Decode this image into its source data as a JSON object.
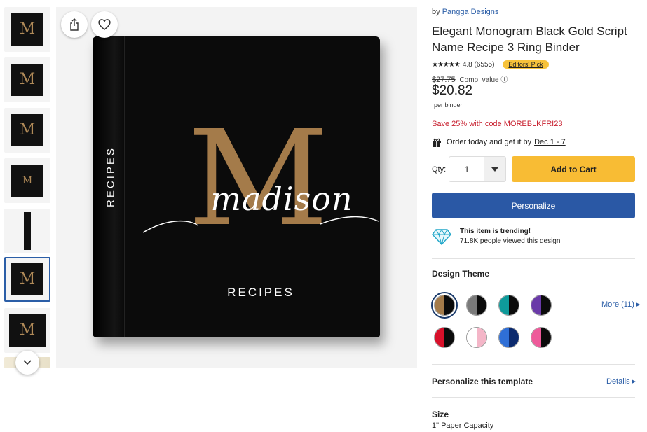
{
  "thumbnails": [
    {
      "kind": "front",
      "label": "M"
    },
    {
      "kind": "front",
      "label": "M"
    },
    {
      "kind": "front",
      "label": "M"
    },
    {
      "kind": "front",
      "label": "M"
    },
    {
      "kind": "spine",
      "label": ""
    },
    {
      "kind": "front",
      "label": "M"
    },
    {
      "kind": "open",
      "label": "M"
    },
    {
      "kind": "partial",
      "label": ""
    }
  ],
  "product_image": {
    "monogram": "M",
    "script_name": "madison",
    "spine_text": "RECIPES",
    "front_text": "RECIPES"
  },
  "product": {
    "by_prefix": "by",
    "designer": "Pangga Designs",
    "title": "Elegant Monogram Black Gold Script Name Recipe 3 Ring Binder",
    "stars": "★★★★★",
    "rating": "4.8",
    "review_count": "(6555)",
    "badge": "Editors' Pick",
    "comp_price": "$27.75",
    "comp_label": "Comp. value",
    "info_icon": "ⓘ",
    "price": "$20.82",
    "per_unit": "per binder",
    "promo": "Save 25% with code MOREBLKFRI23",
    "order_text": "Order today and get it by",
    "delivery_dates": "Dec 1 - 7"
  },
  "purchase": {
    "qty_label": "Qty:",
    "qty_value": "1",
    "add_to_cart": "Add to Cart",
    "personalize": "Personalize"
  },
  "trending": {
    "title": "This item is trending!",
    "subtitle": "71.8K people viewed this design"
  },
  "design_theme": {
    "title": "Design Theme",
    "more_link": "More (11)",
    "swatches": [
      {
        "left": "#a47b4a",
        "right": "#0b0b0b",
        "selected": true
      },
      {
        "left": "#7a7a7a",
        "right": "#0b0b0b",
        "selected": false
      },
      {
        "left": "#0e9a9a",
        "right": "#0b0b0b",
        "selected": false
      },
      {
        "left": "#6a3aa8",
        "right": "#0b0b0b",
        "selected": false
      },
      {
        "left": "#d8102a",
        "right": "#0b0b0b",
        "selected": false
      },
      {
        "left": "#ffffff",
        "right": "#f4b6c8",
        "selected": false
      },
      {
        "left": "#2f6fd6",
        "right": "#0b2a6e",
        "selected": false
      },
      {
        "left": "#ee5a9a",
        "right": "#0b0b0b",
        "selected": false
      }
    ]
  },
  "personalize_section": {
    "title": "Personalize this template",
    "details_link": "Details"
  },
  "size_section": {
    "title": "Size",
    "value": "1\" Paper Capacity"
  },
  "colors": {
    "accent_blue": "#2a58a5",
    "cart_yellow": "#f8bc34",
    "promo_red": "#c8202f",
    "gold": "#a47b4a"
  }
}
